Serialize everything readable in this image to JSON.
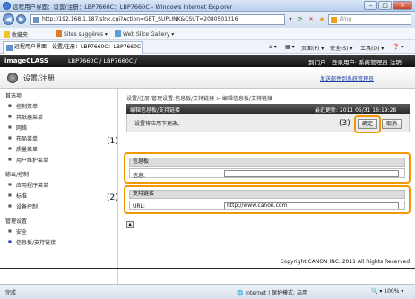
{
  "window": {
    "title": "远程用户界面：设置/注册：LBP7660C：LBP7660C - Windows Internet Explorer",
    "minimize": "–",
    "maximize": "□",
    "close": "✕"
  },
  "address": {
    "back": "◀",
    "forward": "▶",
    "url": "http://192.168.1.187/slnk.cgi?Action=GET_SUPLINK&CSUT=2080501216",
    "search_placeholder": "Bing"
  },
  "favorites": {
    "label": "收藏夹",
    "items": [
      "Sites suggérés ▾",
      "Web Slice Gallery ▾"
    ]
  },
  "tab": {
    "label": "远程用户界面：设置/注册：LBP7660C：LBP7660C",
    "commands": [
      "页面(P) ▾",
      "安全(S) ▾",
      "工具(O) ▾",
      "❓ ▾"
    ]
  },
  "header": {
    "brand": "imageCLASS",
    "device": "LBP7660C / LBP7660C /",
    "portal": "到门户",
    "user": "登录用户: 系统管理员 注销"
  },
  "subheader": {
    "title": "设置/注册",
    "send_link": "发送邮件到系统管理员"
  },
  "sidebar": {
    "sections": [
      {
        "title": "首选项",
        "items": [
          "控制菜单",
          "共纸器菜单",
          "网络",
          "布局菜单",
          "质量菜单",
          "用户维护菜单"
        ]
      },
      {
        "title": "输出/控制",
        "items": [
          "应用程序菜单",
          "标准",
          "设备控制"
        ]
      },
      {
        "title": "管理设置",
        "items": [
          "安全",
          "信息板/支持链接"
        ]
      }
    ]
  },
  "main": {
    "breadcrumb": "设置/注册:管理设置:信息板/支持链接 > 编辑信息板/支持链接",
    "panel_title": "编辑信息板/支持链接",
    "updated": "最近更新: 2011 05/31 16:19:28",
    "notice": "设置将应用下更改。",
    "ok": "确定",
    "cancel": "取消",
    "callouts": [
      "(1)",
      "(2)",
      "(3)"
    ],
    "notice_board": {
      "header": "信息板",
      "label": "信息:",
      "value": ""
    },
    "support_link": {
      "header": "支持链接",
      "label": "URL:",
      "value": "http://www.canon.com"
    },
    "top_icon": "▲"
  },
  "footer": {
    "copyright": "Copyright CANON INC. 2011 All Rights Reserved"
  },
  "status": {
    "left": "完成",
    "zone": "🌐 Internet | 保护模式: 启用",
    "zoom": "🔍 ▾  100% ▾"
  },
  "colors": {
    "accent_orange": "#f39800",
    "header_bg": "#1a1a1a",
    "link": "#1a3fa8"
  }
}
